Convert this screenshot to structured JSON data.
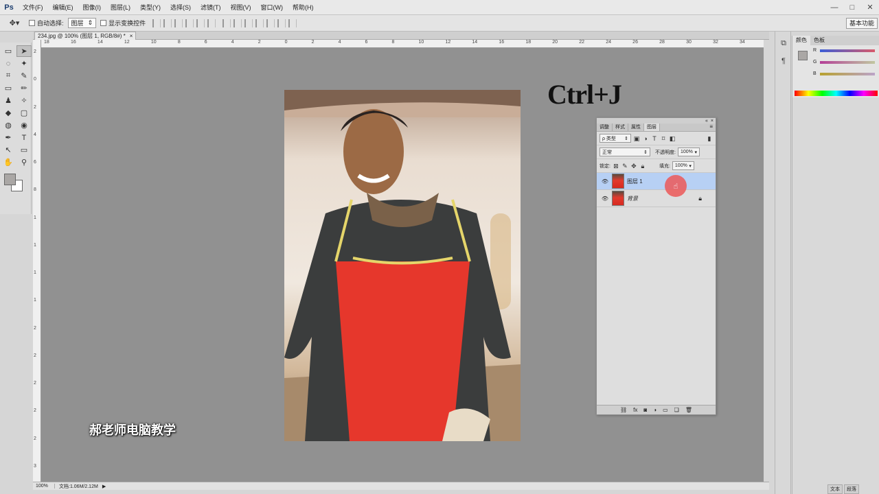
{
  "app": {
    "logo": "Ps",
    "menu": [
      "文件(F)",
      "编辑(E)",
      "图像(I)",
      "图层(L)",
      "类型(Y)",
      "选择(S)",
      "滤镜(T)",
      "视图(V)",
      "窗口(W)",
      "帮助(H)"
    ],
    "window_controls": [
      "—",
      "□",
      "✕"
    ]
  },
  "options_bar": {
    "tool_icon": "move-icon",
    "auto_select_label": "自动选择:",
    "auto_select_value": "图层",
    "show_transform_label": "显示变换控件",
    "workspace": "基本功能"
  },
  "toolbox": {
    "tools": [
      "▭",
      "➤",
      "◌",
      "✦",
      "⌗",
      "✎",
      "▭",
      "✏",
      "♟",
      "✧",
      "◆",
      "▢",
      "◍",
      "◉",
      "✒",
      "T",
      "↖",
      "▭",
      "✋",
      "⚲"
    ],
    "foreground_color": "#aaa7a5",
    "background_color": "#ffffff"
  },
  "document": {
    "tab_title": "234.jpg @ 100% (图层 1, RGB/8#) *",
    "tab_close": "×",
    "ruler_top": [
      "18",
      "16",
      "14",
      "12",
      "10",
      "8",
      "6",
      "4",
      "2",
      "0",
      "2",
      "4",
      "6",
      "8",
      "10",
      "12",
      "14",
      "16",
      "18",
      "20",
      "22",
      "24",
      "26",
      "28",
      "30",
      "32",
      "34"
    ],
    "ruler_left": [
      "2",
      "0",
      "2",
      "4",
      "6",
      "8",
      "1",
      "1",
      "1",
      "1",
      "2",
      "2",
      "2",
      "2",
      "2",
      "3"
    ],
    "overlay_shortcut": "Ctrl+J",
    "watermark": "郝老师电脑教学",
    "canvas_color": "#919191"
  },
  "status_bar": {
    "zoom": "100%",
    "doc_info": "文档:1.06M/2.12M"
  },
  "color_panel": {
    "tabs": [
      "颜色",
      "色板"
    ],
    "channels": [
      "R",
      "G",
      "B"
    ],
    "swatch": "#aaa7a5"
  },
  "layers_panel": {
    "tabs": [
      "调整",
      "样式",
      "属性",
      "图层"
    ],
    "filter_label": "ρ 类型",
    "blend_mode": "正常",
    "opacity_label": "不透明度:",
    "opacity_value": "100%",
    "lock_label": "锁定:",
    "fill_label": "填充:",
    "fill_value": "100%",
    "layers": [
      {
        "name": "图层 1",
        "selected": true
      },
      {
        "name": "背景",
        "selected": false
      }
    ]
  },
  "right_bottom_tabs": [
    "文本",
    "段落"
  ]
}
